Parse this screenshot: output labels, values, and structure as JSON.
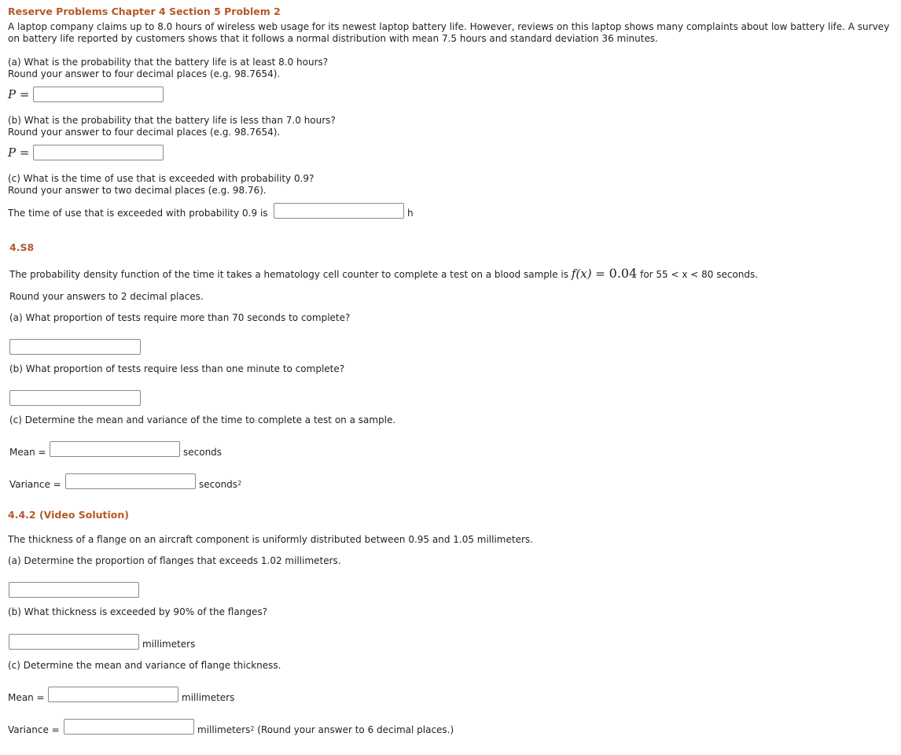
{
  "problem1": {
    "title": "Reserve Problems Chapter 4 Section 5 Problem 2",
    "intro_line1": "A laptop company claims up to 8.0 hours of wireless web usage for its newest laptop battery life. However, reviews on this laptop shows many complaints about low battery life. A survey",
    "intro_line2": "on battery life reported by customers shows that it follows a normal distribution with mean 7.5 hours and standard deviation 36 minutes.",
    "part_a": {
      "question": "(a) What is the probability that the battery life is at least 8.0 hours?",
      "instruction": "Round your answer to four decimal places (e.g. 98.7654).",
      "label": "P =",
      "value": ""
    },
    "part_b": {
      "question": "(b) What is the probability that the battery life is less than 7.0 hours?",
      "instruction": "Round your answer to four decimal places (e.g. 98.7654).",
      "label": "P =",
      "value": ""
    },
    "part_c": {
      "question": "(c) What is the time of use that is exceeded with probability 0.9?",
      "instruction": "Round your answer to two decimal places (e.g. 98.76).",
      "label": "The time of use that is exceeded with probability 0.9 is",
      "unit": "h",
      "value": ""
    }
  },
  "problem2": {
    "title": "4.S8",
    "intro_pre": "The probability density function of the time it takes a hematology cell counter to complete a test on a blood sample is",
    "formula_lhs": "f(x) = ",
    "formula_rhs": "0.04",
    "intro_post": " for 55 < x < 80 seconds.",
    "round_note": "Round your answers to 2 decimal places.",
    "part_a": {
      "question": "(a) What proportion of tests require more than 70 seconds to complete?",
      "value": ""
    },
    "part_b": {
      "question": "(b) What proportion of tests require less than one minute to complete?",
      "value": ""
    },
    "part_c": {
      "question": "(c) Determine the mean and variance of the time to complete a test on a sample.",
      "mean_label": "Mean =",
      "mean_unit": "seconds",
      "mean_value": "",
      "variance_label": "Variance =",
      "variance_unit": "seconds",
      "variance_unit_sup": "2",
      "variance_value": ""
    }
  },
  "problem3": {
    "title": "4.4.2 (Video Solution)",
    "intro": "The thickness of a flange on an aircraft component is uniformly distributed between 0.95 and 1.05 millimeters.",
    "part_a": {
      "question": "(a) Determine the proportion of flanges that exceeds 1.02 millimeters.",
      "value": ""
    },
    "part_b": {
      "question": "(b) What thickness is exceeded by 90% of the flanges?",
      "unit": "millimeters",
      "value": ""
    },
    "part_c": {
      "question": "(c) Determine the mean and variance of flange thickness.",
      "mean_label": "Mean =",
      "mean_unit": "millimeters",
      "mean_value": "",
      "variance_label": "Variance =",
      "variance_unit": "millimeters",
      "variance_unit_sup": "2",
      "variance_note": " (Round your answer to 6 decimal places.)",
      "variance_value": ""
    }
  }
}
